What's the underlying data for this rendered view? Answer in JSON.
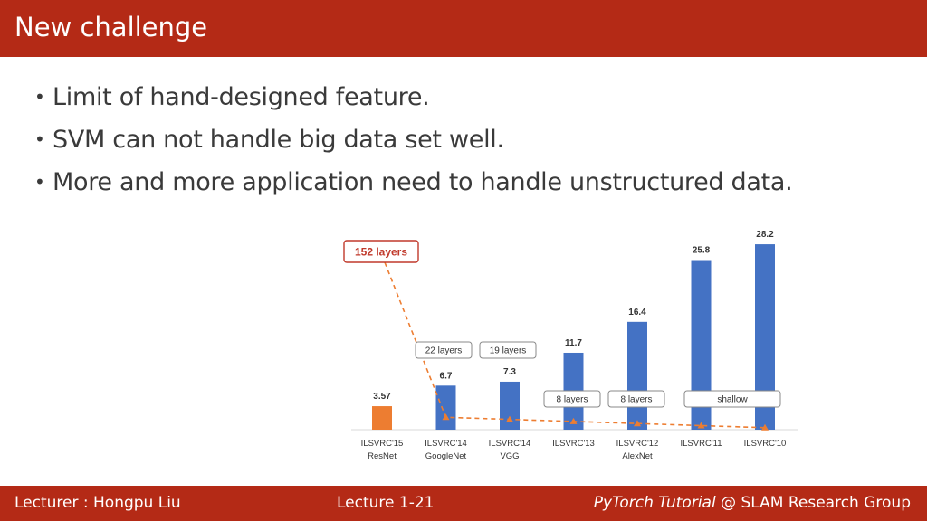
{
  "header": {
    "title": "New challenge"
  },
  "bullets": [
    "Limit of hand-designed feature.",
    "SVM can not handle big data set well.",
    "More and more application need to handle unstructured data."
  ],
  "chart_data": {
    "type": "bar",
    "categories": [
      {
        "line1": "ILSVRC'15",
        "line2": "ResNet"
      },
      {
        "line1": "ILSVRC'14",
        "line2": "GoogleNet"
      },
      {
        "line1": "ILSVRC'14",
        "line2": "VGG"
      },
      {
        "line1": "ILSVRC'13",
        "line2": ""
      },
      {
        "line1": "ILSVRC'12",
        "line2": "AlexNet"
      },
      {
        "line1": "ILSVRC'11",
        "line2": ""
      },
      {
        "line1": "ILSVRC'10",
        "line2": ""
      }
    ],
    "values": [
      3.57,
      6.7,
      7.3,
      11.7,
      16.4,
      25.8,
      28.2
    ],
    "value_labels": [
      "3.57",
      "6.7",
      "7.3",
      "11.7",
      "16.4",
      "25.8",
      "28.2"
    ],
    "depth_labels": [
      "152 layers",
      "22 layers",
      "19 layers",
      "8 layers",
      "8 layers",
      "shallow",
      ""
    ],
    "ylim": [
      0,
      30
    ],
    "colors": {
      "highlight": "#ed7d31",
      "bar": "#4472c4",
      "accent": "#c0392b"
    }
  },
  "footer": {
    "lecturer": "Lecturer : Hongpu Liu",
    "lecture": "Lecture 1-21",
    "course": "PyTorch Tutorial",
    "group": "@ SLAM Research Group"
  }
}
